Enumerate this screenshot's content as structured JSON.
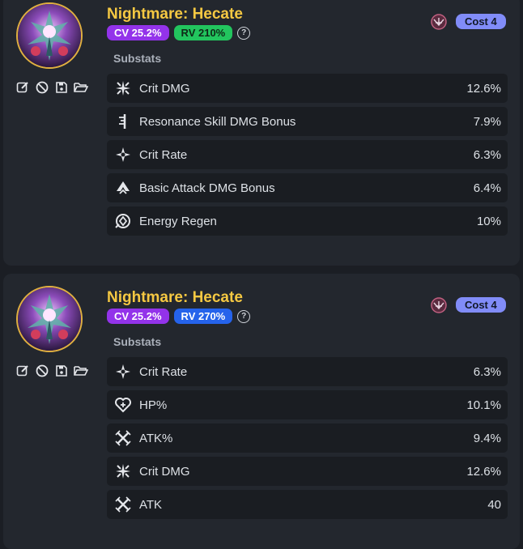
{
  "cards": [
    {
      "title": "Nightmare: Hecate",
      "cv": "CV 25.2%",
      "rv": "RV 210%",
      "help": "?",
      "cost": "Cost 4",
      "substats_label": "Substats",
      "substats": [
        {
          "name": "Crit DMG",
          "value": "12.6%",
          "icon": "crit-dmg-icon"
        },
        {
          "name": "Resonance Skill DMG Bonus",
          "value": "7.9%",
          "icon": "resonance-skill-icon"
        },
        {
          "name": "Crit Rate",
          "value": "6.3%",
          "icon": "crit-rate-icon"
        },
        {
          "name": "Basic Attack DMG Bonus",
          "value": "6.4%",
          "icon": "basic-attack-icon"
        },
        {
          "name": "Energy Regen",
          "value": "10%",
          "icon": "energy-regen-icon"
        }
      ]
    },
    {
      "title": "Nightmare: Hecate",
      "cv": "CV 25.2%",
      "rv": "RV 270%",
      "help": "?",
      "cost": "Cost 4",
      "substats_label": "Substats",
      "substats": [
        {
          "name": "Crit Rate",
          "value": "6.3%",
          "icon": "crit-rate-icon"
        },
        {
          "name": "HP%",
          "value": "10.1%",
          "icon": "hp-icon"
        },
        {
          "name": "ATK%",
          "value": "9.4%",
          "icon": "atk-icon"
        },
        {
          "name": "Crit DMG",
          "value": "12.6%",
          "icon": "crit-dmg-icon"
        },
        {
          "name": "ATK",
          "value": "40",
          "icon": "atk-icon"
        }
      ]
    }
  ],
  "colors": {
    "title": "#f5c842",
    "cv_badge": "#9333ea",
    "rv_badge_card1": "#22c55e",
    "rv_badge_card2": "#2563eb",
    "cost_badge": "#818cf8"
  }
}
